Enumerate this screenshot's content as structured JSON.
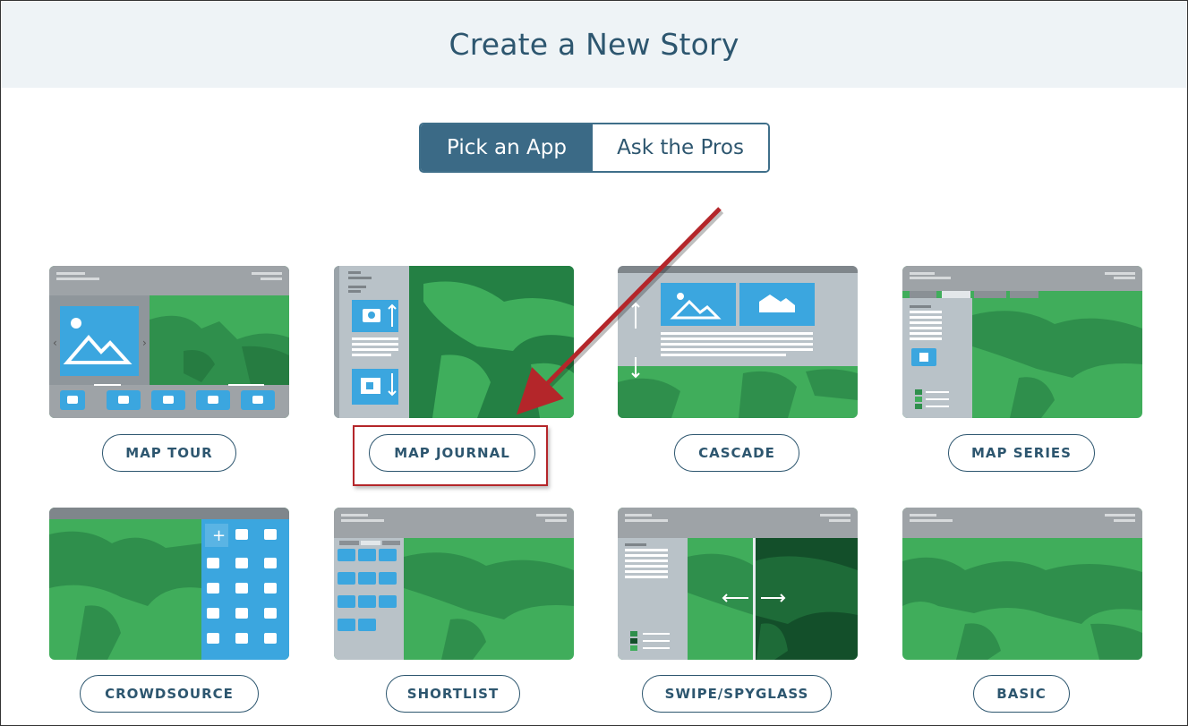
{
  "header": {
    "title": "Create a New Story"
  },
  "toggle": {
    "active_label": "Pick an App",
    "inactive_label": "Ask the Pros"
  },
  "apps": [
    {
      "label": "MAP TOUR"
    },
    {
      "label": "MAP JOURNAL"
    },
    {
      "label": "CASCADE"
    },
    {
      "label": "MAP SERIES"
    },
    {
      "label": "CROWDSOURCE"
    },
    {
      "label": "SHORTLIST"
    },
    {
      "label": "SWIPE/SPYGLASS"
    },
    {
      "label": "BASIC"
    }
  ],
  "colors": {
    "header_bg": "#eef3f6",
    "accent": "#3b6a86",
    "text": "#2d566f",
    "map_green": "#3fae5c",
    "land_green": "#23834a",
    "panel_gray": "#b9c2c8",
    "app_blue": "#3ba6df",
    "annotation_red": "#b4262a"
  },
  "annotation": {
    "highlighted_app": "MAP JOURNAL"
  }
}
